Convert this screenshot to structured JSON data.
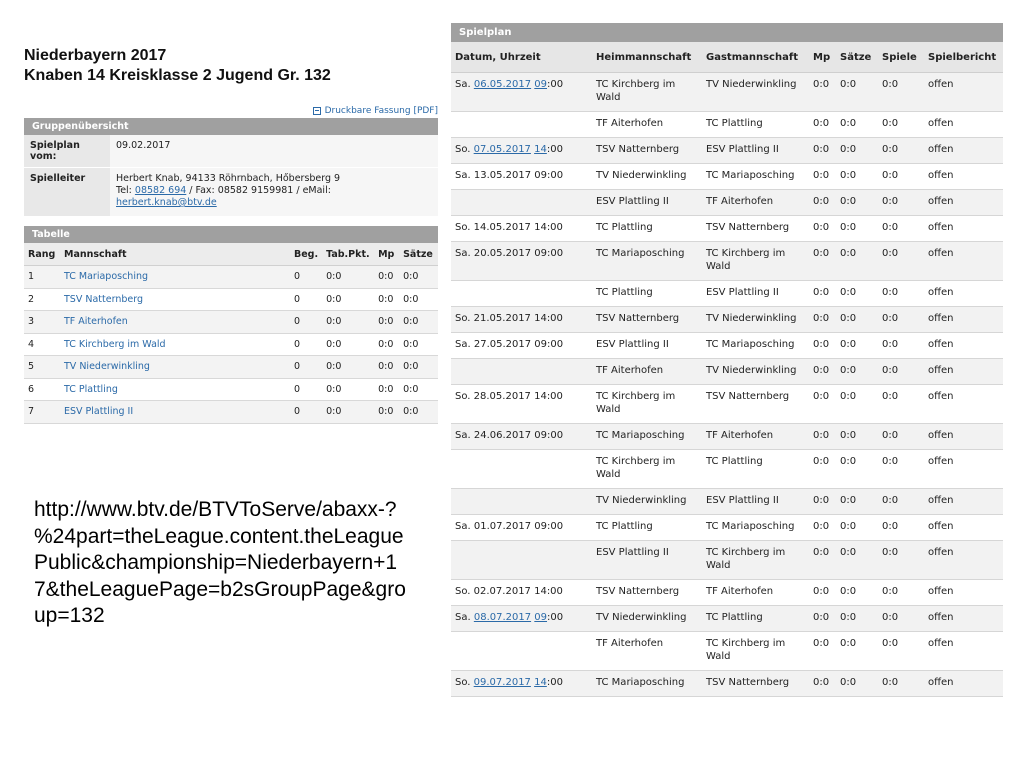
{
  "left": {
    "title_line1": "Niederbayern 2017",
    "title_line2": "Knaben 14 Kreisklasse 2 Jugend Gr. 132",
    "pdf_link": "Druckbare Fassung [PDF]",
    "overview_header": "Gruppenübersicht",
    "spielplan_label": "Spielplan vom:",
    "spielplan_value": "09.02.2017",
    "spielleiter_label": "Spielleiter",
    "spielleiter_line1": "Herbert Knab, 94133 Röhrnbach, Hőbersberg 9",
    "spielleiter_tel_prefix": "Tel: ",
    "spielleiter_tel": "08582 694",
    "spielleiter_fax": " / Fax: 08582 9159981 / eMail:",
    "spielleiter_email": "herbert.knab@btv.de",
    "table_header": "Tabelle",
    "table_cols": [
      "Rang",
      "Mannschaft",
      "Beg.",
      "Tab.Pkt.",
      "Mp",
      "Sätze"
    ],
    "table_rows": [
      {
        "rang": "1",
        "team": "TC Mariaposching",
        "beg": "0",
        "pkt": "0:0",
        "mp": "0:0",
        "saetze": "0:0"
      },
      {
        "rang": "2",
        "team": "TSV Natternberg",
        "beg": "0",
        "pkt": "0:0",
        "mp": "0:0",
        "saetze": "0:0"
      },
      {
        "rang": "3",
        "team": "TF Aiterhofen",
        "beg": "0",
        "pkt": "0:0",
        "mp": "0:0",
        "saetze": "0:0"
      },
      {
        "rang": "4",
        "team": "TC Kirchberg im Wald",
        "beg": "0",
        "pkt": "0:0",
        "mp": "0:0",
        "saetze": "0:0"
      },
      {
        "rang": "5",
        "team": "TV Niederwinkling",
        "beg": "0",
        "pkt": "0:0",
        "mp": "0:0",
        "saetze": "0:0"
      },
      {
        "rang": "6",
        "team": "TC Plattling",
        "beg": "0",
        "pkt": "0:0",
        "mp": "0:0",
        "saetze": "0:0"
      },
      {
        "rang": "7",
        "team": "ESV Plattling II",
        "beg": "0",
        "pkt": "0:0",
        "mp": "0:0",
        "saetze": "0:0"
      }
    ]
  },
  "url_text": "http://www.btv.de/BTVToServe/abaxx-?%24part=theLeague.content.theLeaguePublic&championship=Niederbayern+17&theLeaguePage=b2sGroupPage&group=132",
  "right": {
    "header": "Spielplan",
    "cols": [
      "Datum, Uhrzeit",
      "Heimmannschaft",
      "Gastmannschaft",
      "Mp",
      "Sätze",
      "Spiele",
      "Spielbericht"
    ],
    "rows": [
      {
        "day": "Sa.",
        "date": "06.05.2017",
        "hour": "09",
        "min": ":00",
        "linked": true,
        "home": "TC Kirchberg im Wald",
        "guest": "TV Niederwinkling",
        "mp": "0:0",
        "saetze": "0:0",
        "spiele": "0:0",
        "bericht": "offen"
      },
      {
        "day": "",
        "date": "",
        "hour": "",
        "min": "",
        "linked": false,
        "home": "TF Aiterhofen",
        "guest": "TC Plattling",
        "mp": "0:0",
        "saetze": "0:0",
        "spiele": "0:0",
        "bericht": "offen"
      },
      {
        "day": "So.",
        "date": "07.05.2017",
        "hour": "14",
        "min": ":00",
        "linked": true,
        "home": "TSV Natternberg",
        "guest": "ESV Plattling II",
        "mp": "0:0",
        "saetze": "0:0",
        "spiele": "0:0",
        "bericht": "offen"
      },
      {
        "day": "Sa.",
        "date": "13.05.2017 09:00",
        "hour": "",
        "min": "",
        "linked": false,
        "home": "TV Niederwinkling",
        "guest": "TC Mariaposching",
        "mp": "0:0",
        "saetze": "0:0",
        "spiele": "0:0",
        "bericht": "offen"
      },
      {
        "day": "",
        "date": "",
        "hour": "",
        "min": "",
        "linked": false,
        "home": "ESV Plattling II",
        "guest": "TF Aiterhofen",
        "mp": "0:0",
        "saetze": "0:0",
        "spiele": "0:0",
        "bericht": "offen"
      },
      {
        "day": "So.",
        "date": "14.05.2017 14:00",
        "hour": "",
        "min": "",
        "linked": false,
        "home": "TC Plattling",
        "guest": "TSV Natternberg",
        "mp": "0:0",
        "saetze": "0:0",
        "spiele": "0:0",
        "bericht": "offen"
      },
      {
        "day": "Sa.",
        "date": "20.05.2017 09:00",
        "hour": "",
        "min": "",
        "linked": false,
        "home": "TC Mariaposching",
        "guest": "TC Kirchberg im Wald",
        "mp": "0:0",
        "saetze": "0:0",
        "spiele": "0:0",
        "bericht": "offen"
      },
      {
        "day": "",
        "date": "",
        "hour": "",
        "min": "",
        "linked": false,
        "home": "TC Plattling",
        "guest": "ESV Plattling II",
        "mp": "0:0",
        "saetze": "0:0",
        "spiele": "0:0",
        "bericht": "offen"
      },
      {
        "day": "So.",
        "date": "21.05.2017 14:00",
        "hour": "",
        "min": "",
        "linked": false,
        "home": "TSV Natternberg",
        "guest": "TV Niederwinkling",
        "mp": "0:0",
        "saetze": "0:0",
        "spiele": "0:0",
        "bericht": "offen"
      },
      {
        "day": "Sa.",
        "date": "27.05.2017 09:00",
        "hour": "",
        "min": "",
        "linked": false,
        "home": "ESV Plattling II",
        "guest": "TC Mariaposching",
        "mp": "0:0",
        "saetze": "0:0",
        "spiele": "0:0",
        "bericht": "offen"
      },
      {
        "day": "",
        "date": "",
        "hour": "",
        "min": "",
        "linked": false,
        "home": "TF Aiterhofen",
        "guest": "TV Niederwinkling",
        "mp": "0:0",
        "saetze": "0:0",
        "spiele": "0:0",
        "bericht": "offen"
      },
      {
        "day": "So.",
        "date": "28.05.2017 14:00",
        "hour": "",
        "min": "",
        "linked": false,
        "home": "TC Kirchberg im Wald",
        "guest": "TSV Natternberg",
        "mp": "0:0",
        "saetze": "0:0",
        "spiele": "0:0",
        "bericht": "offen"
      },
      {
        "day": "Sa.",
        "date": "24.06.2017 09:00",
        "hour": "",
        "min": "",
        "linked": false,
        "home": "TC Mariaposching",
        "guest": "TF Aiterhofen",
        "mp": "0:0",
        "saetze": "0:0",
        "spiele": "0:0",
        "bericht": "offen"
      },
      {
        "day": "",
        "date": "",
        "hour": "",
        "min": "",
        "linked": false,
        "home": "TC Kirchberg im Wald",
        "guest": "TC Plattling",
        "mp": "0:0",
        "saetze": "0:0",
        "spiele": "0:0",
        "bericht": "offen"
      },
      {
        "day": "",
        "date": "",
        "hour": "",
        "min": "",
        "linked": false,
        "home": "TV Niederwinkling",
        "guest": "ESV Plattling II",
        "mp": "0:0",
        "saetze": "0:0",
        "spiele": "0:0",
        "bericht": "offen"
      },
      {
        "day": "Sa.",
        "date": "01.07.2017 09:00",
        "hour": "",
        "min": "",
        "linked": false,
        "home": "TC Plattling",
        "guest": "TC Mariaposching",
        "mp": "0:0",
        "saetze": "0:0",
        "spiele": "0:0",
        "bericht": "offen"
      },
      {
        "day": "",
        "date": "",
        "hour": "",
        "min": "",
        "linked": false,
        "home": "ESV Plattling II",
        "guest": "TC Kirchberg im Wald",
        "mp": "0:0",
        "saetze": "0:0",
        "spiele": "0:0",
        "bericht": "offen"
      },
      {
        "day": "So.",
        "date": "02.07.2017 14:00",
        "hour": "",
        "min": "",
        "linked": false,
        "home": "TSV Natternberg",
        "guest": "TF Aiterhofen",
        "mp": "0:0",
        "saetze": "0:0",
        "spiele": "0:0",
        "bericht": "offen"
      },
      {
        "day": "Sa.",
        "date": "08.07.2017",
        "hour": "09",
        "min": ":00",
        "linked": true,
        "home": "TV Niederwinkling",
        "guest": "TC Plattling",
        "mp": "0:0",
        "saetze": "0:0",
        "spiele": "0:0",
        "bericht": "offen"
      },
      {
        "day": "",
        "date": "",
        "hour": "",
        "min": "",
        "linked": false,
        "home": "TF Aiterhofen",
        "guest": "TC Kirchberg im Wald",
        "mp": "0:0",
        "saetze": "0:0",
        "spiele": "0:0",
        "bericht": "offen"
      },
      {
        "day": "So.",
        "date": "09.07.2017",
        "hour": "14",
        "min": ":00",
        "linked": true,
        "home": "TC Mariaposching",
        "guest": "TSV Natternberg",
        "mp": "0:0",
        "saetze": "0:0",
        "spiele": "0:0",
        "bericht": "offen"
      }
    ]
  }
}
